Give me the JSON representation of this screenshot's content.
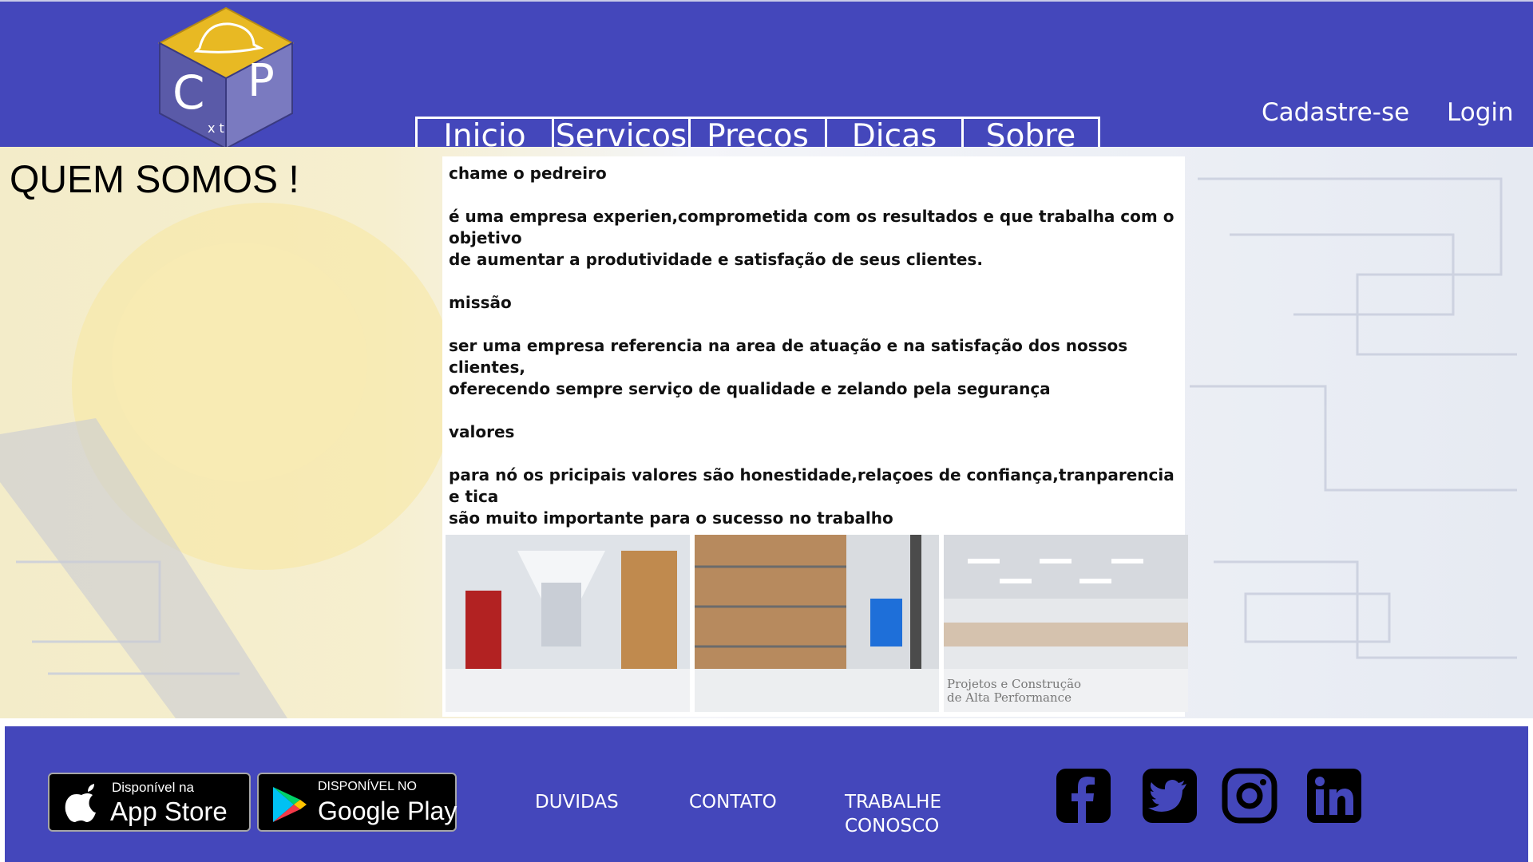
{
  "header": {
    "logo": {
      "letters": [
        "C",
        "P"
      ],
      "small_letters": "x t"
    },
    "nav": [
      {
        "label": "Inicio"
      },
      {
        "label": "Servicos"
      },
      {
        "label": "Precos"
      },
      {
        "label": "Dicas"
      },
      {
        "label": "Sobre"
      }
    ],
    "auth": {
      "register": "Cadastre-se",
      "login": "Login"
    }
  },
  "main": {
    "heading": "QUEM SOMOS !",
    "content": {
      "company_name": "chame o pedreiro",
      "intro_line1": "é uma empresa experien,comprometida com os resultados e que trabalha com o",
      "intro_line2": "objetivo",
      "intro_line3": "de aumentar a produtividade e satisfação de seus clientes.",
      "mission_title": "missão",
      "mission_line1": "ser uma empresa referencia na area de atuação e na satisfação dos nossos clientes,",
      "mission_line2": "oferecendo sempre serviço de qualidade e zelando pela segurança",
      "values_title": "valores",
      "values_line1": "para nó os pricipais valores são honestidade,relaçoes de confiança,tranparencia e tica",
      "values_line2": "são muito importante para o sucesso no trabalho"
    },
    "photos": {
      "caption_line1": "Projetos e Construção",
      "caption_line2": "de Alta Performance"
    }
  },
  "footer": {
    "app_store": {
      "small": "Disponível na",
      "big": "App Store"
    },
    "google_play": {
      "small": "DISPONÍVEL NO",
      "big": "Google Play"
    },
    "links": [
      {
        "label": "DUVIDAS"
      },
      {
        "label": "CONTATO"
      },
      {
        "label": "TRABALHE CONOSCO"
      }
    ],
    "social": [
      "facebook-icon",
      "twitter-icon",
      "instagram-icon",
      "linkedin-icon"
    ]
  },
  "colors": {
    "brand_blue": "#4447bb",
    "logo_yellow": "#e8b923",
    "logo_purple": "#5a5aa8"
  }
}
